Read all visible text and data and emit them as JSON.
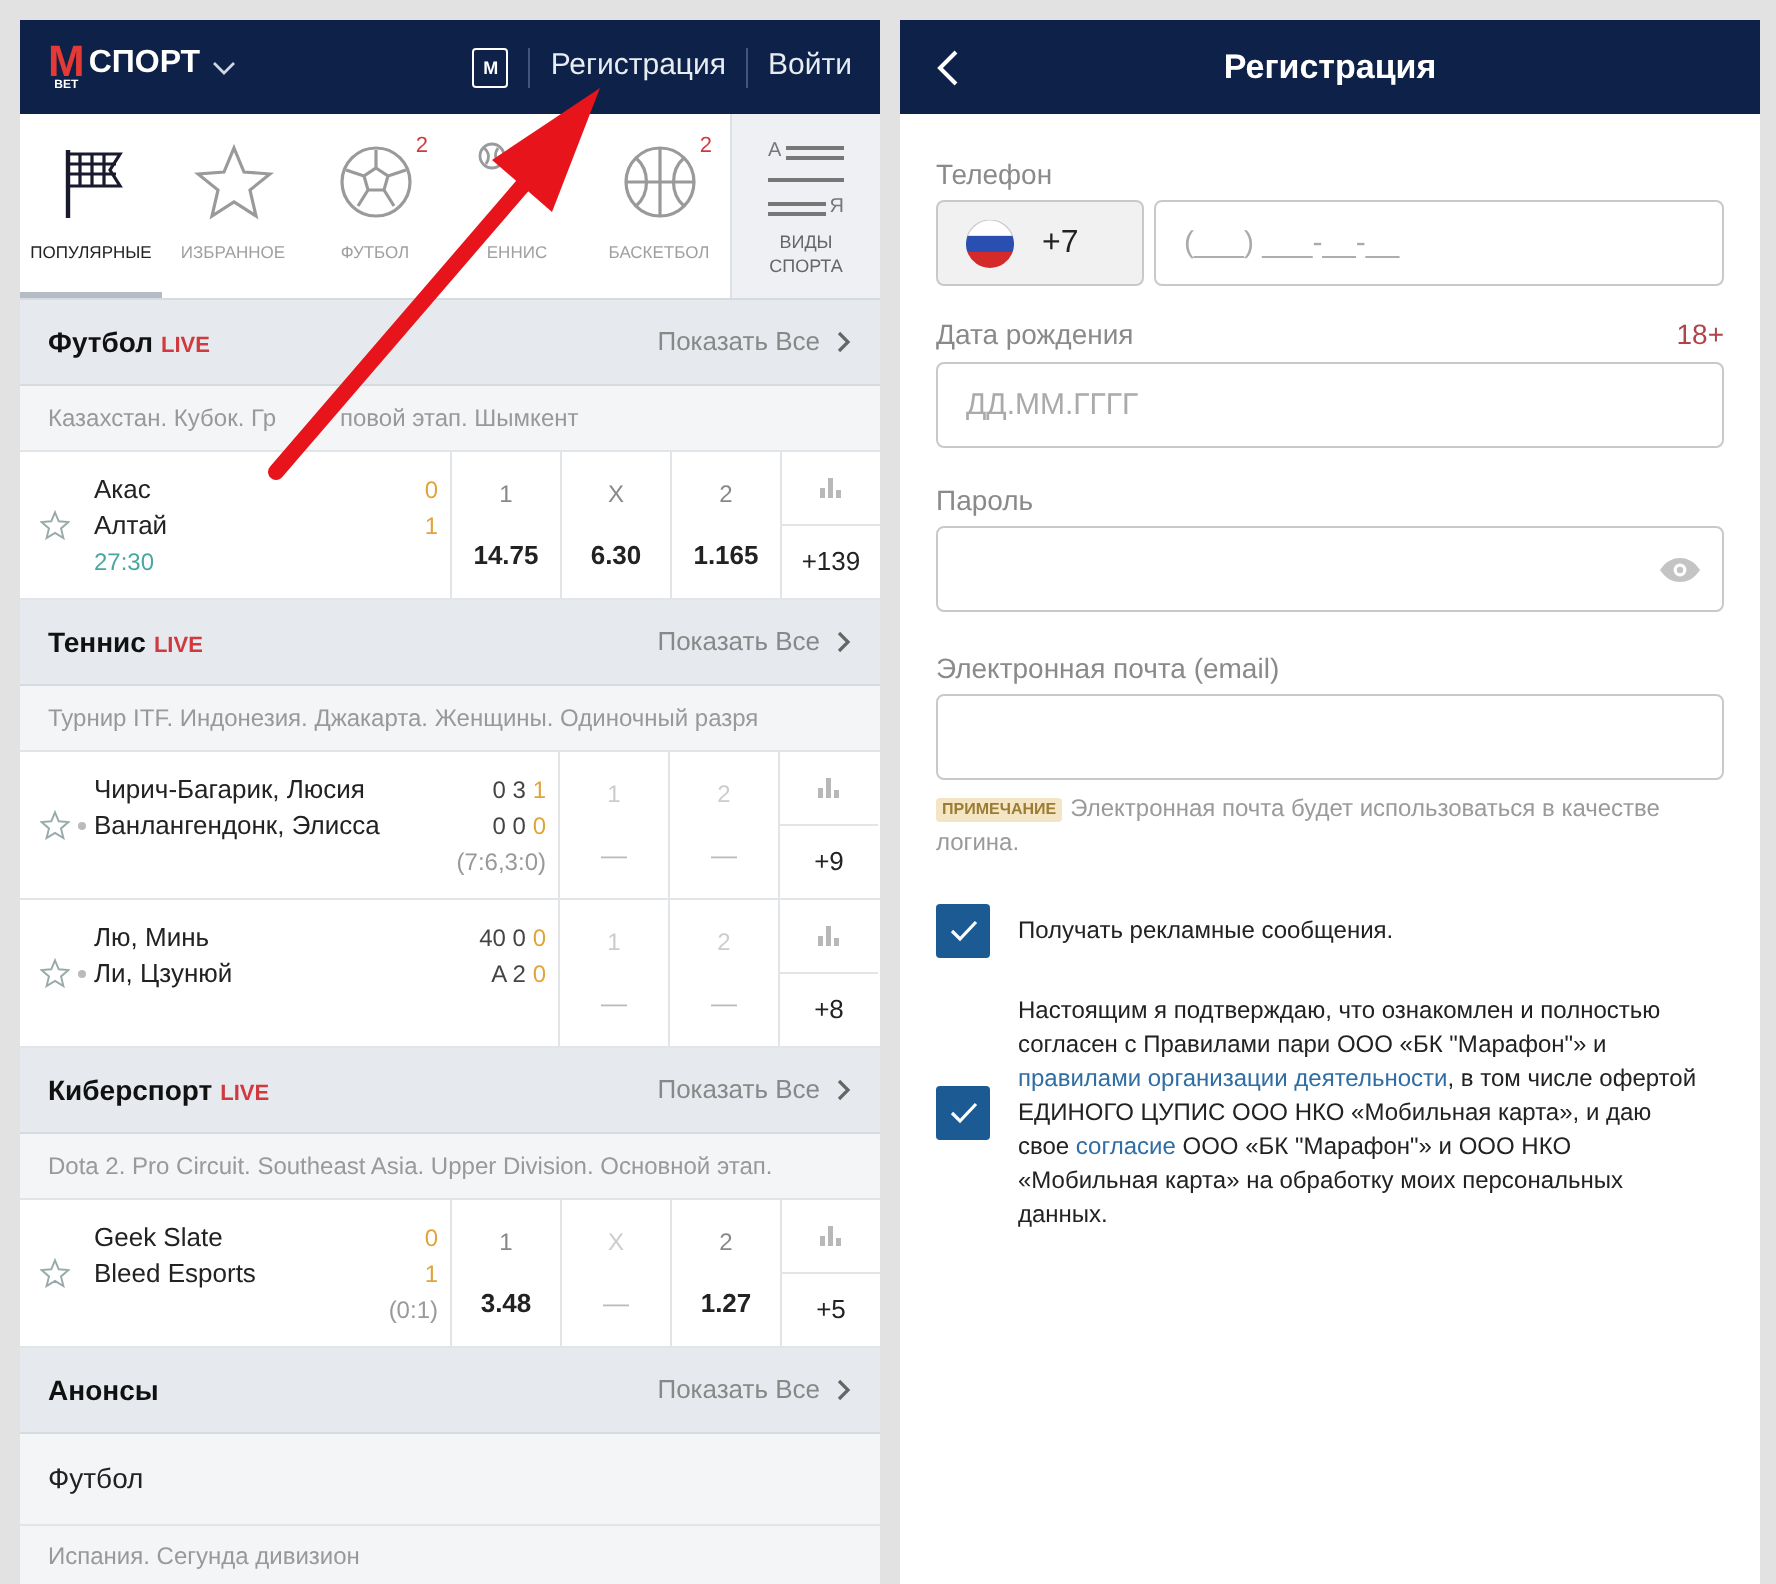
{
  "left": {
    "header": {
      "logo_letter": "M",
      "logo_sub": "BET",
      "title": "СПОРТ",
      "gift_letter": "М",
      "links": [
        "Регистрация",
        "Войти"
      ]
    },
    "sport_tabs": [
      {
        "kind": "flag",
        "label": "ПОПУЛЯРНЫЕ",
        "selected": true
      },
      {
        "kind": "star",
        "label": "ИЗБРАННОЕ",
        "selected": false
      },
      {
        "kind": "football",
        "label": "ФУТБОЛ",
        "badge": "2",
        "selected": false
      },
      {
        "kind": "tennis",
        "label": "ЕННИС",
        "selected": false
      },
      {
        "kind": "basketball",
        "label": "БАСКЕТБОЛ",
        "badge": "2",
        "selected": false
      }
    ],
    "all_sports": {
      "icon_top": "А",
      "icon_bottom": "Я",
      "label": "ВИДЫ СПОРТА"
    },
    "sections": [
      {
        "title": "Футбол",
        "live": "LIVE",
        "show_all": "Показать Все",
        "league": "Казахстан. Кубок. Гр",
        "league_rest": "повой этап. Шымкент",
        "matches": [
          {
            "kind": "three",
            "teams": [
              {
                "name": "Акас",
                "serving": false,
                "current": "0"
              },
              {
                "name": "Алтай",
                "serving": false,
                "current": "1"
              }
            ],
            "time": "27:30",
            "odds": [
              {
                "label": "1",
                "value": "14.75",
                "available": true
              },
              {
                "label": "X",
                "value": "6.30",
                "available": true
              },
              {
                "label": "2",
                "value": "1.165",
                "available": true
              }
            ],
            "more": "+139"
          }
        ]
      },
      {
        "title": "Теннис",
        "live": "LIVE",
        "show_all": "Показать Все",
        "league": "Турнир ITF. Индонезия. Джакарта. Женщины. Одиночный разря",
        "matches": [
          {
            "kind": "two",
            "teams": [
              {
                "name": "Чирич-Багарик, Люсия",
                "serving": false,
                "score": "0 3",
                "current": "1"
              },
              {
                "name": "Ванлангендонк, Элисса",
                "serving": true,
                "score": "0 0",
                "current": "0"
              }
            ],
            "sets": "(7:6,3:0)",
            "odds": [
              {
                "label": "1",
                "value": "—",
                "available": false
              },
              {
                "label": "2",
                "value": "—",
                "available": false
              }
            ],
            "more": "+9"
          },
          {
            "kind": "two",
            "teams": [
              {
                "name": "Лю, Минь",
                "serving": false,
                "score": "40 0",
                "current": "0"
              },
              {
                "name": "Ли, Цзунюй",
                "serving": true,
                "score": "A 2",
                "current": "0"
              }
            ],
            "odds": [
              {
                "label": "1",
                "value": "—",
                "available": false
              },
              {
                "label": "2",
                "value": "—",
                "available": false
              }
            ],
            "more": "+8"
          }
        ]
      },
      {
        "title": "Киберспорт",
        "live": "LIVE",
        "show_all": "Показать Все",
        "league": "Dota 2. Pro Circuit. Southeast Asia. Upper Division. Основной этап.",
        "matches": [
          {
            "kind": "three",
            "teams": [
              {
                "name": "Geek Slate",
                "serving": false,
                "current": "0"
              },
              {
                "name": "Bleed Esports",
                "serving": false,
                "current": "1"
              }
            ],
            "sets": "(0:1)",
            "odds": [
              {
                "label": "1",
                "value": "3.48",
                "available": true
              },
              {
                "label": "X",
                "value": "—",
                "available": false
              },
              {
                "label": "2",
                "value": "1.27",
                "available": true
              }
            ],
            "more": "+5"
          }
        ]
      }
    ],
    "announcements": {
      "title": "Анонсы",
      "show_all": "Показать Все",
      "sport": "Футбол",
      "league": "Испания. Сегунда дивизион"
    }
  },
  "right": {
    "title": "Регистрация",
    "phone": {
      "label": "Телефон",
      "code": "+7",
      "placeholder": "(___) ___-__-__"
    },
    "birth": {
      "label": "Дата рождения",
      "badge": "18+",
      "placeholder": "ДД.ММ.ГГГГ"
    },
    "password": {
      "label": "Пароль"
    },
    "email": {
      "label": "Электронная почта (email)"
    },
    "note": {
      "tag": "ПРИМЕЧАНИЕ",
      "text": "Электронная почта будет использоваться в качестве логина."
    },
    "checkboxes": [
      {
        "checked": true,
        "parts": [
          {
            "text": "Получать рекламные сообщения.",
            "kind": "text"
          }
        ]
      },
      {
        "checked": true,
        "parts": [
          {
            "text": "Настоящим я подтверждаю, что ознакомлен и полностью согласен с Правилами пари ООО «БК \"Марафон\"» и ",
            "kind": "text"
          },
          {
            "text": "правилами организации деятельности",
            "kind": "link"
          },
          {
            "text": ", в том числе офертой ЕДИНОГО ЦУПИС ООО НКО «Мобильная карта», и даю свое ",
            "kind": "text"
          },
          {
            "text": "согласие",
            "kind": "link"
          },
          {
            "text": " ООО «БК \"Марафон\"» и ООО НКО «Мобильная карта» на обработку моих персональных данных.",
            "kind": "text"
          }
        ]
      }
    ]
  }
}
